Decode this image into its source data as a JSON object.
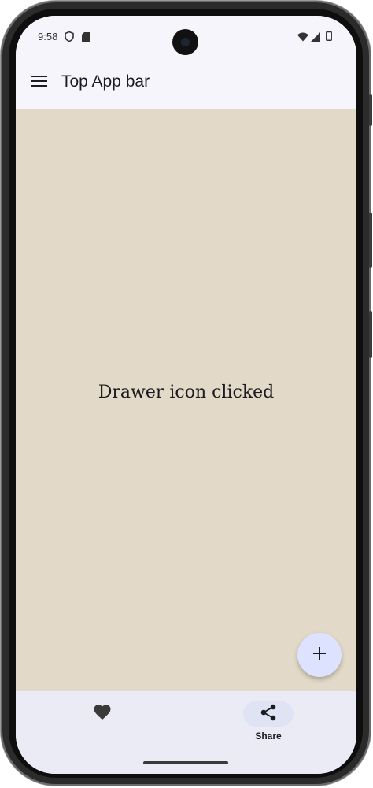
{
  "status_bar": {
    "time": "9:58",
    "left_icons": [
      "shield-icon",
      "sd-card-icon"
    ],
    "right_icons": [
      "wifi-icon",
      "signal-icon",
      "battery-icon"
    ]
  },
  "app_bar": {
    "nav_icon": "menu-icon",
    "title": "Top App bar"
  },
  "content": {
    "message": "Drawer icon clicked",
    "background": "#e2d9c8"
  },
  "fab": {
    "icon": "plus-icon",
    "color": "#dde3ff"
  },
  "bottom_nav": {
    "items": [
      {
        "icon": "heart-icon",
        "label": "",
        "selected": false
      },
      {
        "icon": "share-icon",
        "label": "Share",
        "selected": true
      }
    ]
  },
  "colors": {
    "surface": "#f7f5fc",
    "nav_background": "#ebebf5",
    "on_surface": "#1c1b1f"
  }
}
